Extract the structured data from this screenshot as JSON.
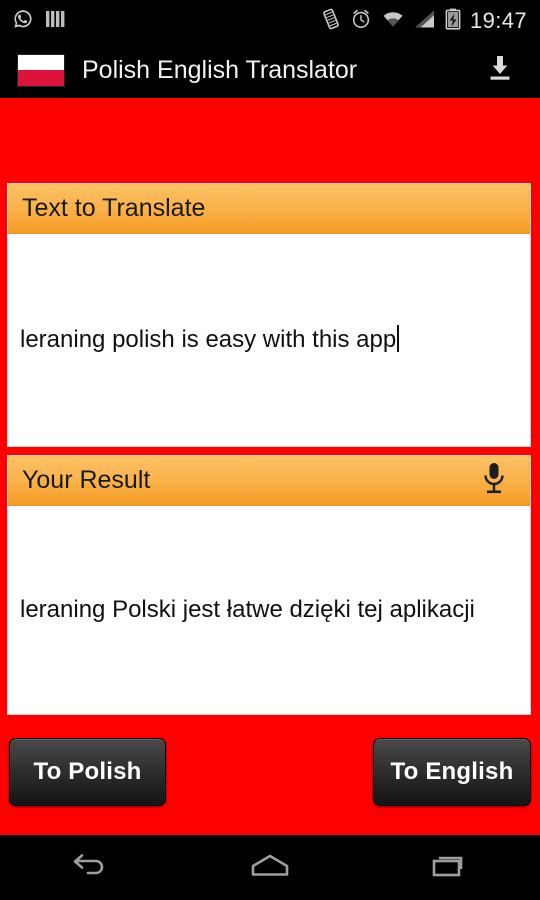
{
  "statusbar": {
    "time": "19:47",
    "left_icons": [
      {
        "name": "whatsapp-icon",
        "label": "WhatsApp"
      },
      {
        "name": "bars-icon",
        "label": "Bars"
      }
    ],
    "right_icons": [
      {
        "name": "vibrate-icon",
        "label": "Vibrate"
      },
      {
        "name": "alarm-clock-icon",
        "label": "Alarm"
      },
      {
        "name": "wifi-icon",
        "label": "Wi-Fi"
      },
      {
        "name": "cell-signal-icon",
        "label": "Signal"
      },
      {
        "name": "battery-charging-icon",
        "label": "Battery charging"
      }
    ]
  },
  "actionbar": {
    "title": "Polish English Translator",
    "flag_icon": "polish-flag-icon",
    "download_icon": "download-icon"
  },
  "panels": {
    "input": {
      "header": "Text to Translate",
      "value": "leraning polish is easy with this app",
      "placeholder": "Text to Translate"
    },
    "result": {
      "header": "Your Result",
      "value": "leraning Polski jest łatwe dzięki tej aplikacji",
      "mic_icon": "microphone-icon"
    }
  },
  "buttons": {
    "to_polish": "To Polish",
    "to_english": "To English"
  },
  "navbar": {
    "back": "back-icon",
    "home": "home-icon",
    "recents": "recents-icon"
  },
  "colors": {
    "background_red": "#FF0000",
    "header_orange_top": "#FBC164",
    "header_orange_bottom": "#F59C26",
    "flag_red": "#DC143C",
    "button_dark": "#2E2E2E",
    "bar_black": "#000000"
  }
}
